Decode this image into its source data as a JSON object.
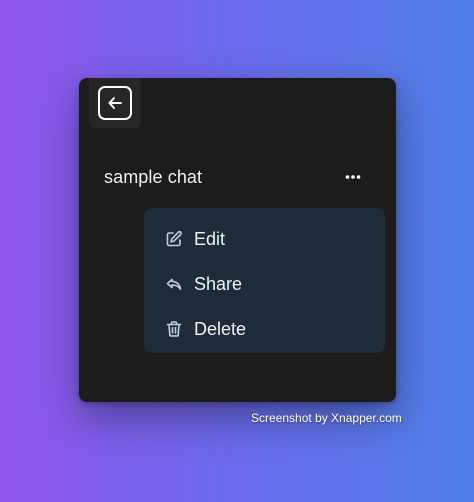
{
  "card": {
    "back_icon": "arrow-left-square-icon",
    "chat_title": "sample chat",
    "more_icon": "ellipsis-horizontal-icon"
  },
  "menu": {
    "items": [
      {
        "label": "Edit",
        "icon": "pencil-square-icon"
      },
      {
        "label": "Share",
        "icon": "share-arrow-icon"
      },
      {
        "label": "Delete",
        "icon": "trash-icon"
      }
    ]
  },
  "watermark": "Screenshot by Xnapper.com",
  "colors": {
    "card_background": "#1c1c1d",
    "menu_background": "#202b3a",
    "text": "#f1f1f1",
    "gradient_start": "#8f55ea",
    "gradient_end": "#4f7fe6"
  }
}
